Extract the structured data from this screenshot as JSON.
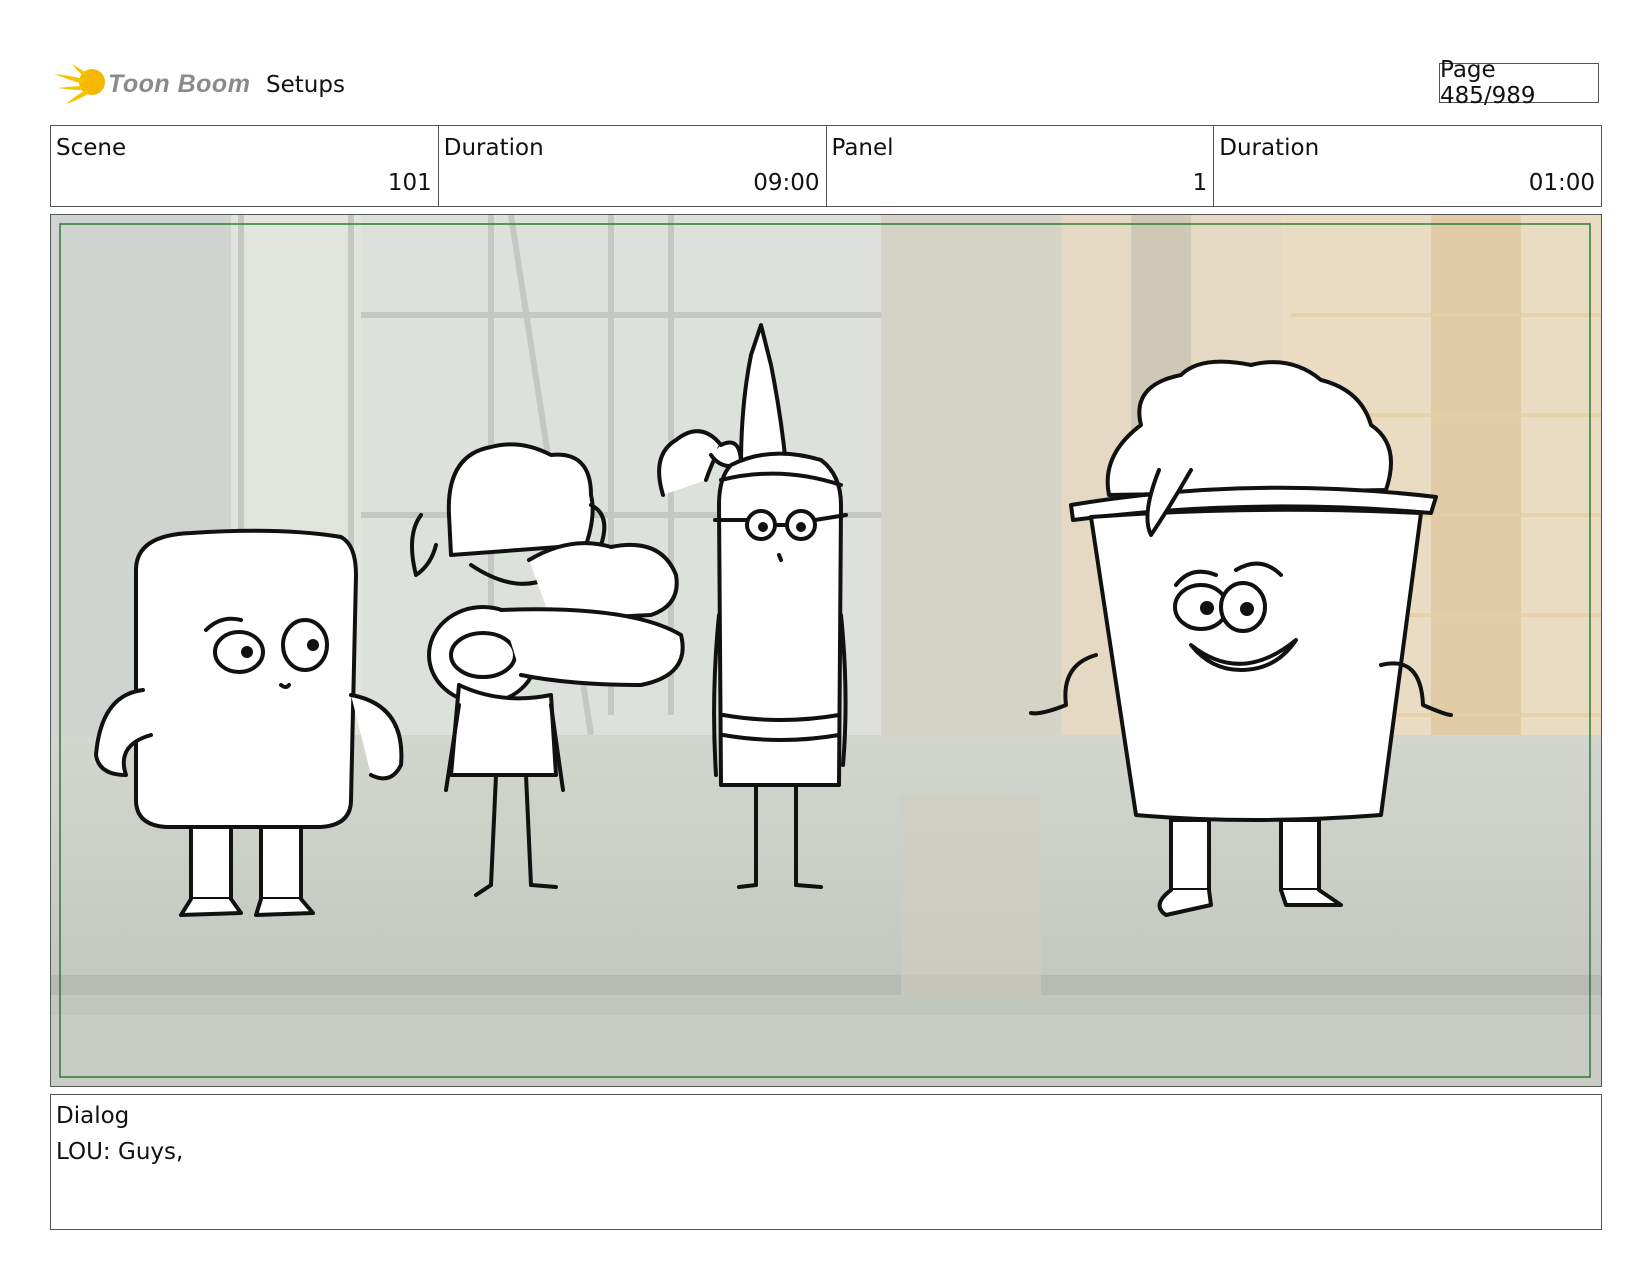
{
  "header": {
    "brand_name": "Toon Boom",
    "title": "Setups",
    "page_label": "Page 485/989"
  },
  "info": {
    "scene_label": "Scene",
    "scene_value": "101",
    "scene_duration_label": "Duration",
    "scene_duration_value": "09:00",
    "panel_label": "Panel",
    "panel_value": "1",
    "panel_duration_label": "Duration",
    "panel_duration_value": "01:00"
  },
  "dialog": {
    "label": "Dialog",
    "text": "LOU: Guys,"
  },
  "colors": {
    "safe_frame": "#2e7d32",
    "logo_sun": "#f5b800"
  }
}
